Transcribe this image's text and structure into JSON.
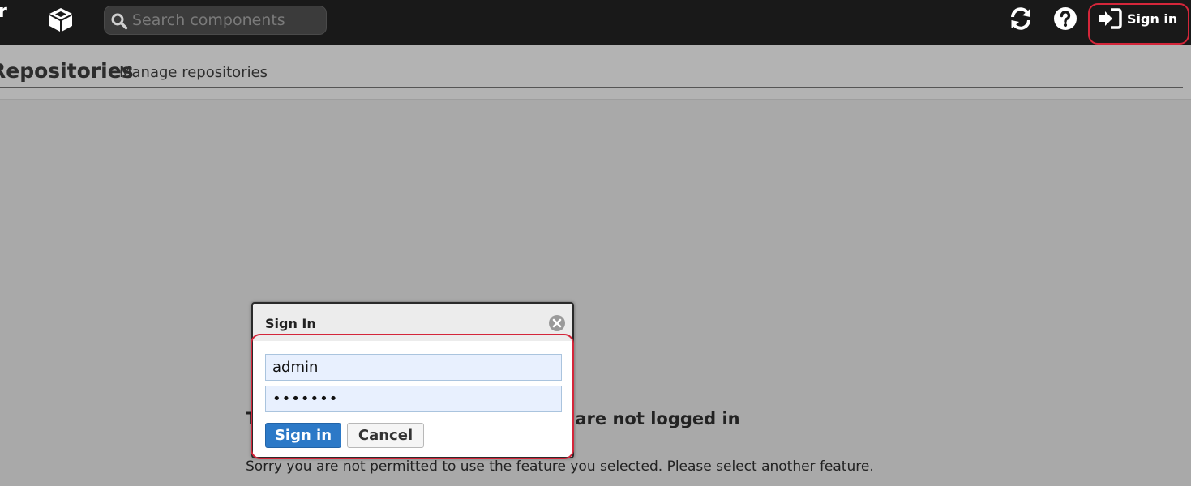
{
  "topbar": {
    "logo_fragment": "r",
    "search": {
      "placeholder": "Search components",
      "value": ""
    },
    "signin_label": "Sign in"
  },
  "header": {
    "title": "Repositories",
    "subtitle": "Manage repositories"
  },
  "notice": {
    "heading": "This feature is unavailable as you are not logged in",
    "text": "Sorry you are not permitted to use the feature you selected. Please select another feature."
  },
  "dialog": {
    "title": "Sign In",
    "username": "admin",
    "password": "1234567",
    "signin_label": "Sign in",
    "cancel_label": "Cancel"
  },
  "colors": {
    "topbar": "#191919",
    "backdrop": "#a9a9a9",
    "primary_button": "#2c79c7",
    "highlight_ring": "#d4263a"
  }
}
